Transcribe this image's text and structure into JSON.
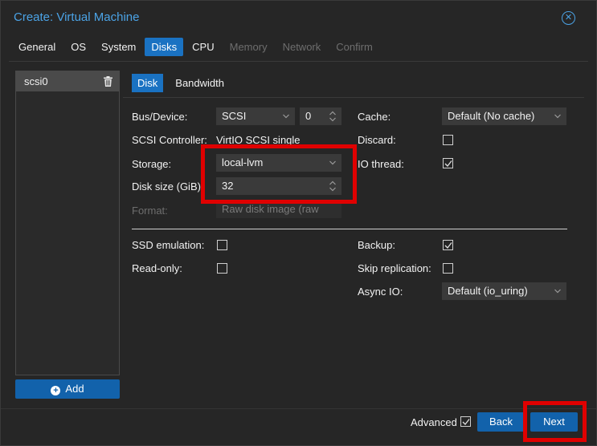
{
  "window": {
    "title": "Create: Virtual Machine"
  },
  "tabs": [
    {
      "label": "General",
      "state": "normal"
    },
    {
      "label": "OS",
      "state": "normal"
    },
    {
      "label": "System",
      "state": "normal"
    },
    {
      "label": "Disks",
      "state": "active"
    },
    {
      "label": "CPU",
      "state": "normal"
    },
    {
      "label": "Memory",
      "state": "disabled"
    },
    {
      "label": "Network",
      "state": "disabled"
    },
    {
      "label": "Confirm",
      "state": "disabled"
    }
  ],
  "devices": [
    {
      "label": "scsi0"
    }
  ],
  "add_button": {
    "label": "Add"
  },
  "subtabs": [
    {
      "label": "Disk",
      "state": "active"
    },
    {
      "label": "Bandwidth",
      "state": "normal"
    }
  ],
  "left_form": {
    "bus_device_label": "Bus/Device:",
    "bus_value": "SCSI",
    "device_number": "0",
    "scsi_controller_label": "SCSI Controller:",
    "scsi_controller_value": "VirtIO SCSI single",
    "storage_label": "Storage:",
    "storage_value": "local-lvm",
    "disk_size_label": "Disk size (GiB):",
    "disk_size_value": "32",
    "format_label": "Format:",
    "format_value": "Raw disk image (raw"
  },
  "right_form": {
    "cache_label": "Cache:",
    "cache_value": "Default (No cache)",
    "discard_label": "Discard:",
    "discard_checked": false,
    "io_thread_label": "IO thread:",
    "io_thread_checked": true
  },
  "advanced_left": {
    "ssd_label": "SSD emulation:",
    "ssd_checked": false,
    "readonly_label": "Read-only:",
    "readonly_checked": false
  },
  "advanced_right": {
    "backup_label": "Backup:",
    "backup_checked": true,
    "skip_replication_label": "Skip replication:",
    "skip_replication_checked": false,
    "async_io_label": "Async IO:",
    "async_io_value": "Default (io_uring)"
  },
  "footer": {
    "advanced_label": "Advanced",
    "advanced_checked": true,
    "back_label": "Back",
    "next_label": "Next"
  },
  "colors": {
    "accent": "#1a72c2",
    "button": "#1262ab",
    "title": "#4ba3e6",
    "highlight": "#e00000"
  }
}
